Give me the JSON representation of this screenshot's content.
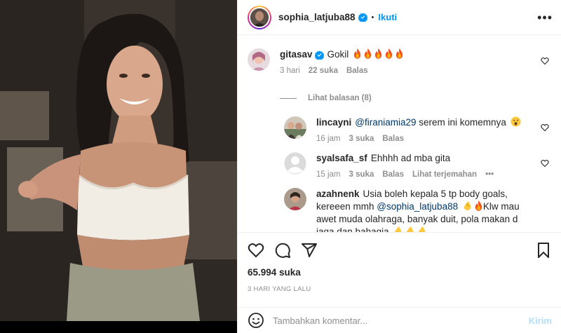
{
  "header": {
    "username": "sophia_latjuba88",
    "dot": "•",
    "follow_label": "Ikuti",
    "more_label": "•••",
    "verified_icon": "verified-badge-icon"
  },
  "comments": [
    {
      "user": "gitasav",
      "text": "Gokil",
      "emojis": 5,
      "time": "3 hari",
      "likes": "22 suka",
      "reply": "Balas",
      "verified": true
    },
    {
      "view_replies": "Lihat balasan (8)"
    },
    {
      "user": "lincayni",
      "mention": "@firaniamia29",
      "text": " serem ini komemnya",
      "time": "16 jam",
      "likes": "3 suka",
      "reply": "Balas"
    },
    {
      "user": "syalsafa_sf",
      "text": "Ehhhh ad mba gita",
      "time": "15 jam",
      "likes": "3 suka",
      "reply": "Balas",
      "translate": "Lihat terjemahan",
      "more": "•••"
    },
    {
      "user": "azahnenk",
      "text1": "Usia boleh kepala 5 tp body goals, kereeen mmh ",
      "mention": "@sophia_latjuba88",
      "text2": "Klw mau awet muda olahraga, banyak duit, pola makan d jaga dan bahagia"
    }
  ],
  "footer": {
    "likes": "65.994 suka",
    "time": "3 HARI YANG LALU",
    "comment_placeholder": "Tambahkan komentar...",
    "post_label": "Kirim"
  },
  "colors": {
    "link_blue": "#0095f6",
    "mention": "#00376b",
    "muted": "#8e8e8e",
    "post_disabled": "#b2dffc"
  }
}
